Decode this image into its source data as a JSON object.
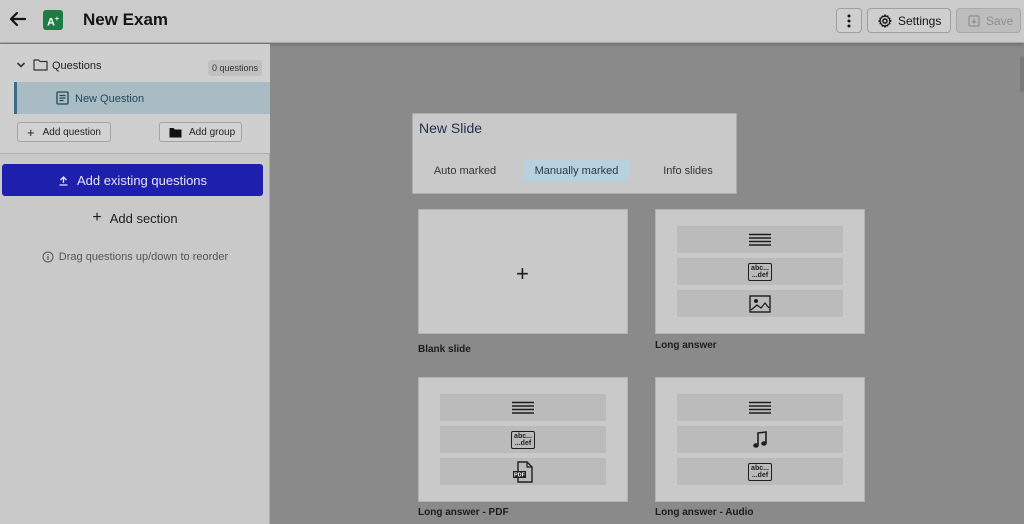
{
  "header": {
    "title": "New Exam",
    "app_badge": "A",
    "settings_label": "Settings",
    "save_label": "Save"
  },
  "sidebar": {
    "folder_label": "Questions",
    "folder_count": "0 questions",
    "active_item": "New Question",
    "add_question_label": "Add question",
    "add_group_label": "Add group",
    "add_existing_label": "Add existing questions",
    "add_section_label": "Add section",
    "drag_hint": "Drag questions up/down to reorder"
  },
  "new_slide": {
    "title": "New Slide",
    "tabs": [
      {
        "label": "Auto marked",
        "active": false
      },
      {
        "label": "Manually marked",
        "active": true
      },
      {
        "label": "Info slides",
        "active": false
      }
    ]
  },
  "templates": [
    {
      "label": "Blank slide",
      "icons": [
        "plus-icon"
      ]
    },
    {
      "label": "Long answer",
      "icons": [
        "text-lines-icon",
        "abc-def-icon",
        "image-icon"
      ]
    },
    {
      "label": "Long answer - PDF",
      "icons": [
        "text-lines-icon",
        "abc-def-icon",
        "pdf-icon"
      ]
    },
    {
      "label": "Long answer - Audio",
      "icons": [
        "text-lines-icon",
        "music-note-icon",
        "abc-def-icon"
      ]
    }
  ],
  "glyphs": {
    "abc": "abc...",
    "def": "...def",
    "plus": "+",
    "pdf": "PDF"
  },
  "colors": {
    "accent_button": "#1f1fae",
    "active_tab": "#b7d1dd",
    "app_badge": "#1f7a45"
  }
}
